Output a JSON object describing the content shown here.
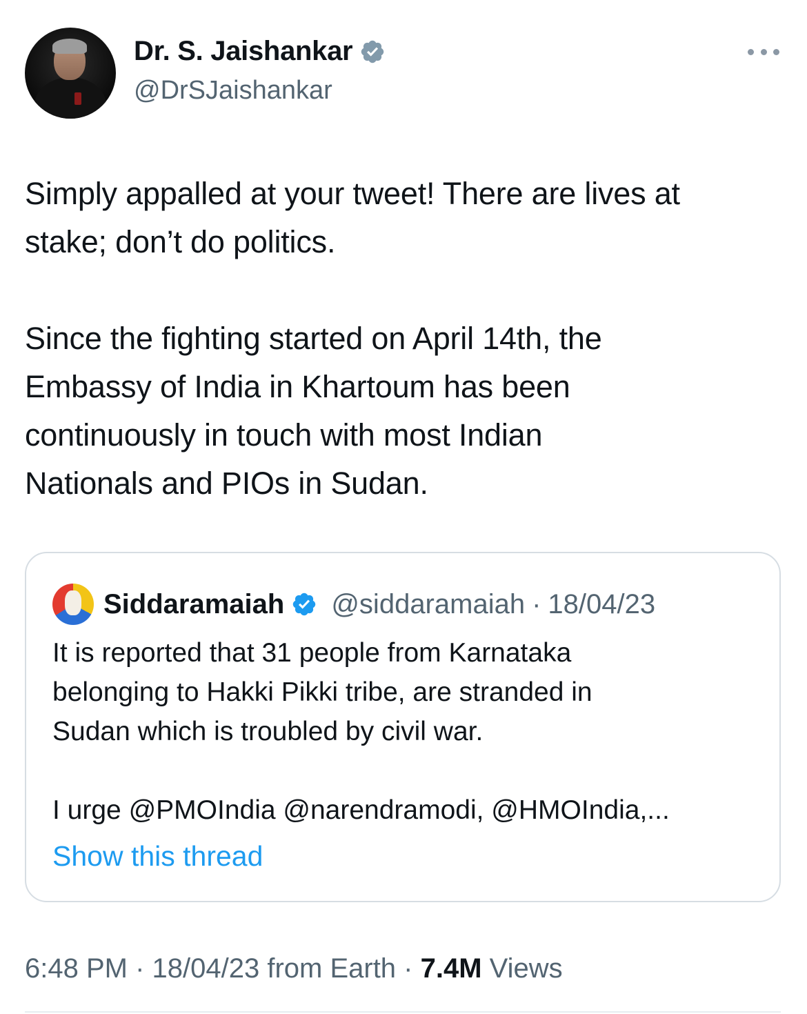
{
  "author": {
    "display_name": "Dr. S. Jaishankar",
    "handle": "@DrSJaishankar",
    "verified_icon": "verified-badge-icon",
    "verified_color": "#829aab"
  },
  "tweet": {
    "text": "Simply appalled at your tweet! There are lives at\nstake; don’t do politics.\n\nSince the fighting started on April 14th, the\nEmbassy of India in Khartoum has been\ncontinuously in touch with most Indian\nNationals and PIOs in Sudan."
  },
  "quoted": {
    "display_name": "Siddaramaiah",
    "handle": "@siddaramaiah",
    "separator": "·",
    "date": "18/04/23",
    "verified_color": "#1d9bf0",
    "text": "It is reported that 31 people from Karnataka\nbelonging to Hakki Pikki tribe, are stranded in\nSudan which is troubled by civil war.\n\nI urge @PMOIndia @narendramodi, @HMOIndia,...",
    "show_thread_label": "Show this thread"
  },
  "meta": {
    "time": "6:48 PM",
    "sep1": " · ",
    "date": "18/04/23",
    "source": " from Earth",
    "sep2": " · ",
    "views_count": "7.4M",
    "views_label": " Views"
  },
  "colors": {
    "link": "#1d9bf0",
    "secondary_text": "#536471",
    "primary_text": "#0f1419",
    "border": "#d6dde3"
  }
}
